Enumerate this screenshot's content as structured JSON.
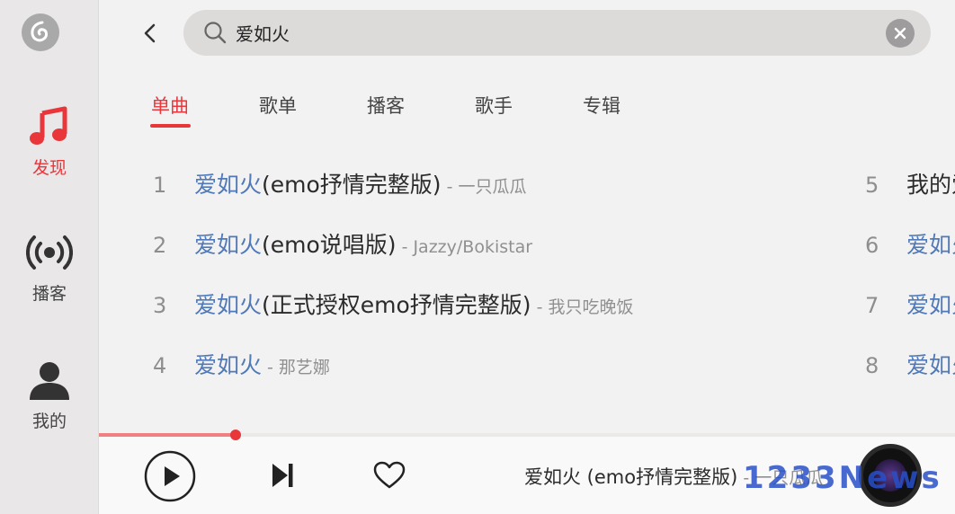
{
  "sidebar": {
    "items": [
      {
        "label": "发现",
        "icon": "music-note-icon"
      },
      {
        "label": "播客",
        "icon": "podcast-broadcast-icon"
      },
      {
        "label": "我的",
        "icon": "user-icon"
      }
    ]
  },
  "search": {
    "query": "爱如火"
  },
  "tabs": [
    {
      "label": "单曲"
    },
    {
      "label": "歌单"
    },
    {
      "label": "播客"
    },
    {
      "label": "歌手"
    },
    {
      "label": "专辑"
    }
  ],
  "songs_left": [
    {
      "num": "1",
      "hl": "爱如火",
      "rest": " (emo抒情完整版)",
      "artist": "- 一只瓜瓜"
    },
    {
      "num": "2",
      "hl": "爱如火",
      "rest": " (emo说唱版)",
      "artist": "- Jazzy/Bokistar"
    },
    {
      "num": "3",
      "hl": "爱如火",
      "rest": " (正式授权emo抒情完整版)",
      "artist": "- 我只吃晚饭"
    },
    {
      "num": "4",
      "hl": "爱如火",
      "rest": "",
      "artist": "- 那艺娜"
    }
  ],
  "songs_right": [
    {
      "num": "5",
      "hl": "",
      "rest": "我的爱",
      "artist": ""
    },
    {
      "num": "6",
      "hl": "爱如火",
      "rest": "",
      "artist": ""
    },
    {
      "num": "7",
      "hl": "爱如火",
      "rest": "",
      "artist": ""
    },
    {
      "num": "8",
      "hl": "爱如火",
      "rest": "",
      "artist": ""
    }
  ],
  "player": {
    "title": "爱如火 (emo抒情完整版)",
    "artist": " - 一只瓜瓜",
    "progress": 0.16,
    "watermark": "1233News"
  },
  "colors": {
    "accent": "#e8363b",
    "highlight": "#4f79b8"
  }
}
